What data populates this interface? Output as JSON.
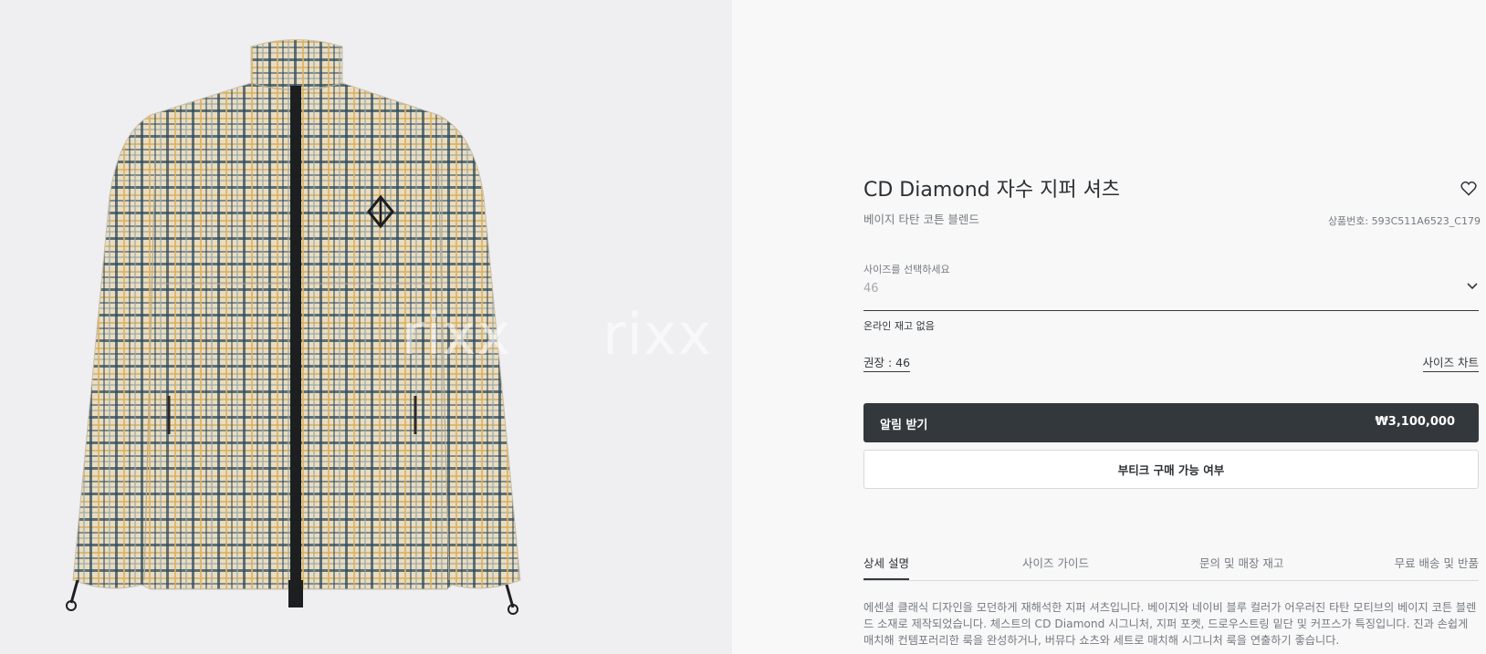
{
  "product": {
    "title": "CD Diamond 자수 지퍼 셔츠",
    "subtitle": "베이지 타탄 코튼 블렌드",
    "sku": "상품번호: 593C511A6523_C179",
    "favorite_icon": "heart-icon"
  },
  "size": {
    "label": "사이즈를 선택하세요",
    "value": "46",
    "stock_status": "온라인 재고 없음",
    "recommended": "권장 : 46",
    "size_chart_link": "사이즈 차트"
  },
  "actions": {
    "notify_label": "알림 받기",
    "price": "₩3,100,000",
    "boutique_label": "부티크 구매 가능 여부"
  },
  "tabs": [
    {
      "label": "상세 설명",
      "active": true
    },
    {
      "label": "사이즈 가이드",
      "active": false
    },
    {
      "label": "문의 및 매장 재고",
      "active": false
    },
    {
      "label": "무료 배송 및 반품",
      "active": false
    }
  ],
  "description": "에센셜 클래식 디자인을 모던하게 재해석한 지퍼 셔츠입니다. 베이지와 네이비 블루 컬러가 어우러진 타탄 모티브의 베이지 코튼 블렌드 소재로 제작되었습니다. 체스트의 CD Diamond 시그니처, 지퍼 포켓, 드로우스트링 밑단 및 커프스가 특징입니다. 진과 손쉽게 매치해 컨템포러리한 룩을 완성하거나, 버뮤다 쇼츠와 세트로 매치해 시그니처 룩을 연출하기 좋습니다.",
  "watermark": [
    "rixx",
    "rixx",
    "rixx",
    "rixx"
  ],
  "colors": {
    "primary_button": "#33383c",
    "left_panel_bg": "#efeff2",
    "right_panel_bg": "#f8f8f9",
    "plaid_base": "#e9dcc0",
    "plaid_navy": "#2f4a5c",
    "plaid_gold": "#d9b060"
  }
}
